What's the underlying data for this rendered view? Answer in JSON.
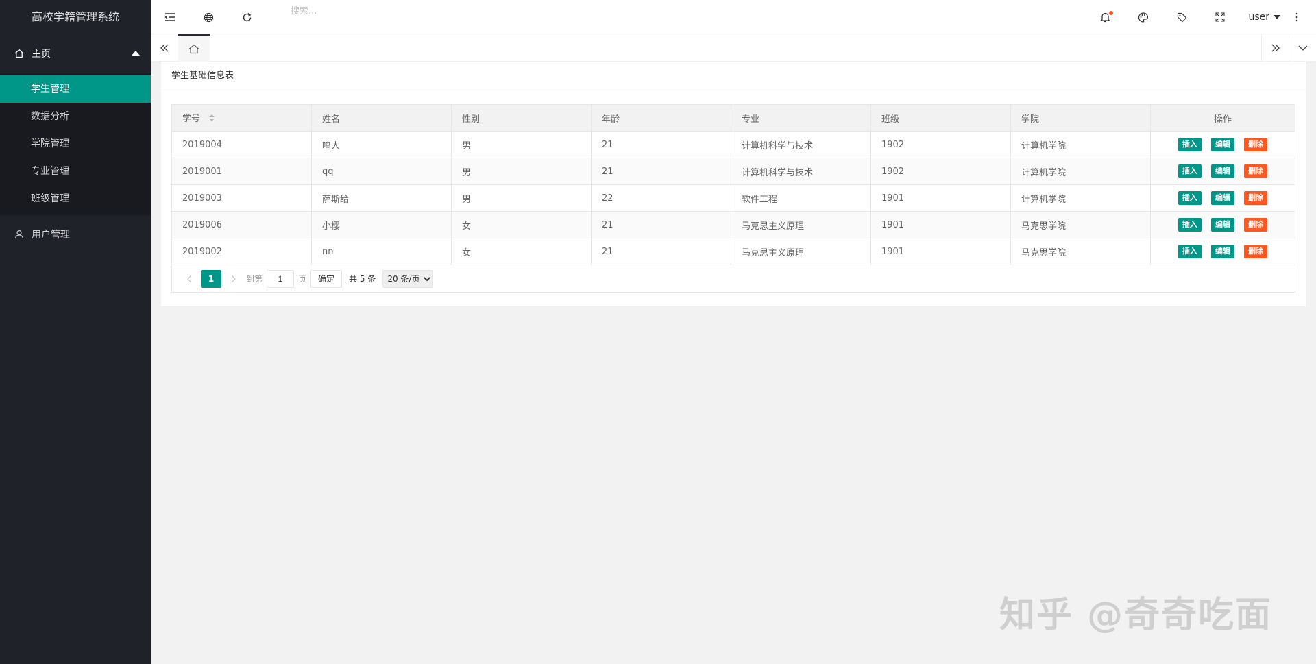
{
  "app": {
    "title": "高校学籍管理系统"
  },
  "sidebar": {
    "home": {
      "label": "主页"
    },
    "items": [
      {
        "label": "学生管理",
        "active": true
      },
      {
        "label": "数据分析"
      },
      {
        "label": "学院管理"
      },
      {
        "label": "专业管理"
      },
      {
        "label": "班级管理"
      }
    ],
    "user_group": {
      "label": "用户管理"
    }
  },
  "header": {
    "search_placeholder": "搜索...",
    "user_label": "user",
    "accent_color": "#009688",
    "badge_color": "#ff5722"
  },
  "card": {
    "title": "学生基础信息表"
  },
  "table": {
    "columns": [
      "学号",
      "姓名",
      "性别",
      "年龄",
      "专业",
      "班级",
      "学院",
      "操作"
    ],
    "rows": [
      {
        "id": "2019004",
        "name": "鸣人",
        "gender": "男",
        "age": "21",
        "major": "计算机科学与技术",
        "class": "1902",
        "college": "计算机学院"
      },
      {
        "id": "2019001",
        "name": "qq",
        "gender": "男",
        "age": "21",
        "major": "计算机科学与技术",
        "class": "1902",
        "college": "计算机学院"
      },
      {
        "id": "2019003",
        "name": "萨斯给",
        "gender": "男",
        "age": "22",
        "major": "软件工程",
        "class": "1901",
        "college": "计算机学院"
      },
      {
        "id": "2019006",
        "name": "小樱",
        "gender": "女",
        "age": "21",
        "major": "马克思主义原理",
        "class": "1901",
        "college": "马克思学院"
      },
      {
        "id": "2019002",
        "name": "nn",
        "gender": "女",
        "age": "21",
        "major": "马克思主义原理",
        "class": "1901",
        "college": "马克思学院"
      }
    ],
    "actions": {
      "insert": "插入",
      "edit": "编辑",
      "delete": "删除"
    }
  },
  "pager": {
    "current": "1",
    "goto_label": "到第",
    "page_input": "1",
    "page_unit": "页",
    "confirm": "确定",
    "total": "共 5 条",
    "page_size": "20 条/页"
  },
  "watermark": "知乎 @奇奇吃面"
}
